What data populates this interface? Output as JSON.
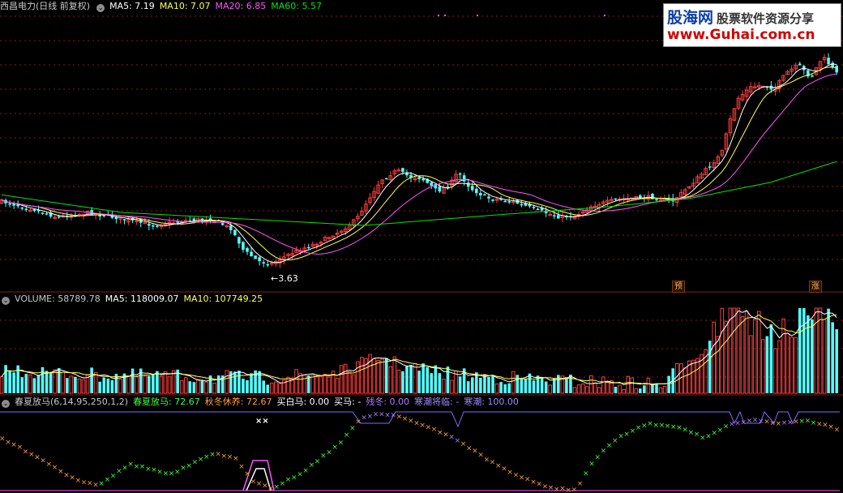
{
  "price_panel": {
    "stock_name": "西昌电力",
    "period": "(日线 前复权)",
    "ma5": "MA5: 7.19",
    "ma10": "MA10: 7.07",
    "ma20": "MA20: 6.85",
    "ma60": "MA60: 5.57",
    "low_marker": "←3.63",
    "tag_yu": "预",
    "tag_zhang": "涨"
  },
  "volume_panel": {
    "volume": "VOLUME: 58789.78",
    "ma5": "MA5: 118009.07",
    "ma10": "MA10: 107749.25"
  },
  "indicator_panel": {
    "name": "春夏放马(6,14,95,250,1,2)",
    "chunxia": "春夏放马: 72.67",
    "qiudong": "秋冬休养: 72.67",
    "maibaima": "买白马: 0.00",
    "maima": "买马: -",
    "candong": "残冬: 0.00",
    "hanchao_jl": "寒潮将临: -",
    "hanchao": "寒潮: 100.00"
  },
  "watermark": {
    "line1": "股海网",
    "line1b": "股票软件资源分享",
    "line2": "www.Guhai.com.cn"
  },
  "colors": {
    "up": "#ff3c3c",
    "down": "#54ffff",
    "ma5": "#ffffff",
    "ma10": "#ffff54",
    "ma20": "#ff54ff",
    "ma60": "#00e600",
    "grid": "#8b1a1a",
    "orange": "#ff9d3c",
    "green": "#3cff3c",
    "violet": "#b07cff"
  }
}
